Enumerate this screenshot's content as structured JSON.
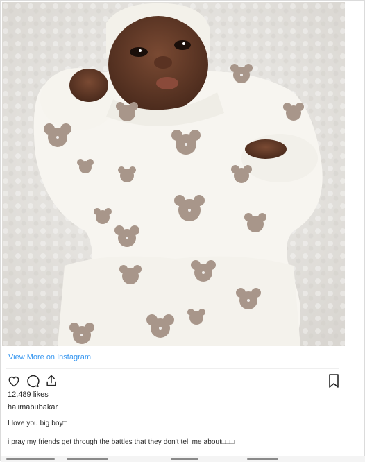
{
  "post": {
    "view_more_label": "View More on Instagram",
    "likes": "12,489 likes",
    "username": "halimabubakar",
    "caption_lines": [
      "I love you big boy□",
      "i pray my friends get through the battles that they don't tell me about□□□"
    ]
  },
  "icons": {
    "like": "heart-icon",
    "comment": "comment-bubble-icon",
    "share": "share-icon",
    "save": "bookmark-icon"
  },
  "colors": {
    "link": "#3897f0",
    "text": "#262626",
    "border": "#dbdbdb",
    "pattern": "#a8968a",
    "blanket": "#e9e7e3"
  }
}
